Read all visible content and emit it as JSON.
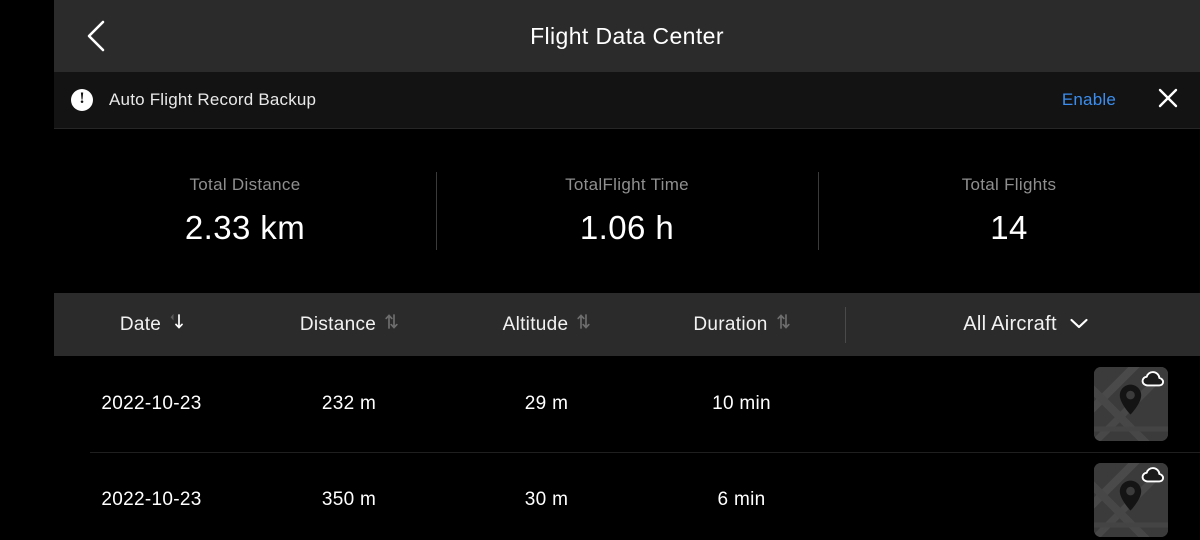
{
  "navbar": {
    "back_icon": "chevron-left-icon",
    "title": "Flight Data Center"
  },
  "banner": {
    "alert_icon": "exclamation-circle-icon",
    "message": "Auto Flight Record Backup",
    "enable_label": "Enable",
    "close_icon": "close-icon",
    "enable_color": "#3b8ef0"
  },
  "stats": [
    {
      "label": "Total Distance",
      "value": "2.33 km"
    },
    {
      "label": "TotalFlight Time",
      "value": "1.06 h"
    },
    {
      "label": "Total Flights",
      "value": "14"
    }
  ],
  "table": {
    "columns": [
      {
        "label": "Date",
        "sort_icon": "sort-arrows-icon",
        "sort_state": "descending"
      },
      {
        "label": "Distance",
        "sort_icon": "sort-arrows-icon",
        "sort_state": "none"
      },
      {
        "label": "Altitude",
        "sort_icon": "sort-arrows-icon",
        "sort_state": "none"
      },
      {
        "label": "Duration",
        "sort_icon": "sort-arrows-icon",
        "sort_state": "none"
      }
    ],
    "filter": {
      "label": "All Aircraft",
      "chevron_icon": "chevron-down-icon"
    },
    "rows": [
      {
        "date": "2022-10-23",
        "distance": "232 m",
        "altitude": "29 m",
        "duration": "10 min",
        "thumbnail": "map-thumbnail",
        "pin_icon": "map-pin-icon",
        "cloud_icon": "cloud-icon"
      },
      {
        "date": "2022-10-23",
        "distance": "350 m",
        "altitude": "30 m",
        "duration": "6 min",
        "thumbnail": "map-thumbnail",
        "pin_icon": "map-pin-icon",
        "cloud_icon": "cloud-icon"
      }
    ]
  }
}
